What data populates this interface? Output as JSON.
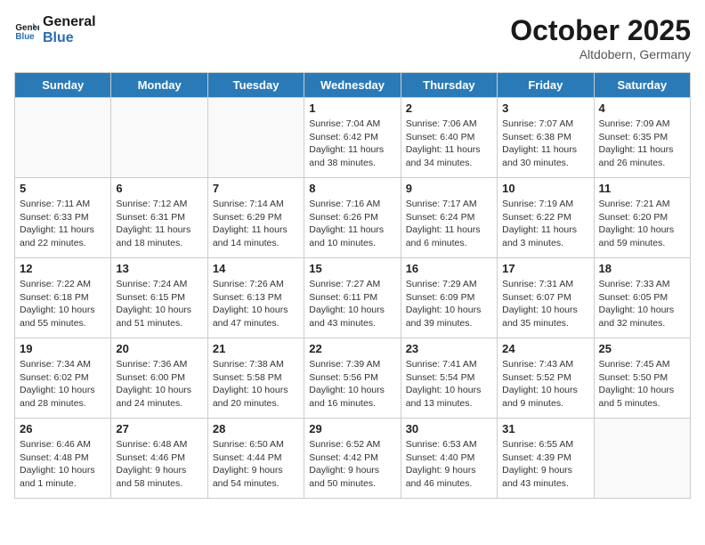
{
  "header": {
    "logo_line1": "General",
    "logo_line2": "Blue",
    "month": "October 2025",
    "location": "Altdobern, Germany"
  },
  "weekdays": [
    "Sunday",
    "Monday",
    "Tuesday",
    "Wednesday",
    "Thursday",
    "Friday",
    "Saturday"
  ],
  "weeks": [
    [
      {
        "day": null,
        "info": null
      },
      {
        "day": null,
        "info": null
      },
      {
        "day": null,
        "info": null
      },
      {
        "day": "1",
        "sunrise": "7:04 AM",
        "sunset": "6:42 PM",
        "daylight": "11 hours and 38 minutes."
      },
      {
        "day": "2",
        "sunrise": "7:06 AM",
        "sunset": "6:40 PM",
        "daylight": "11 hours and 34 minutes."
      },
      {
        "day": "3",
        "sunrise": "7:07 AM",
        "sunset": "6:38 PM",
        "daylight": "11 hours and 30 minutes."
      },
      {
        "day": "4",
        "sunrise": "7:09 AM",
        "sunset": "6:35 PM",
        "daylight": "11 hours and 26 minutes."
      }
    ],
    [
      {
        "day": "5",
        "sunrise": "7:11 AM",
        "sunset": "6:33 PM",
        "daylight": "11 hours and 22 minutes."
      },
      {
        "day": "6",
        "sunrise": "7:12 AM",
        "sunset": "6:31 PM",
        "daylight": "11 hours and 18 minutes."
      },
      {
        "day": "7",
        "sunrise": "7:14 AM",
        "sunset": "6:29 PM",
        "daylight": "11 hours and 14 minutes."
      },
      {
        "day": "8",
        "sunrise": "7:16 AM",
        "sunset": "6:26 PM",
        "daylight": "11 hours and 10 minutes."
      },
      {
        "day": "9",
        "sunrise": "7:17 AM",
        "sunset": "6:24 PM",
        "daylight": "11 hours and 6 minutes."
      },
      {
        "day": "10",
        "sunrise": "7:19 AM",
        "sunset": "6:22 PM",
        "daylight": "11 hours and 3 minutes."
      },
      {
        "day": "11",
        "sunrise": "7:21 AM",
        "sunset": "6:20 PM",
        "daylight": "10 hours and 59 minutes."
      }
    ],
    [
      {
        "day": "12",
        "sunrise": "7:22 AM",
        "sunset": "6:18 PM",
        "daylight": "10 hours and 55 minutes."
      },
      {
        "day": "13",
        "sunrise": "7:24 AM",
        "sunset": "6:15 PM",
        "daylight": "10 hours and 51 minutes."
      },
      {
        "day": "14",
        "sunrise": "7:26 AM",
        "sunset": "6:13 PM",
        "daylight": "10 hours and 47 minutes."
      },
      {
        "day": "15",
        "sunrise": "7:27 AM",
        "sunset": "6:11 PM",
        "daylight": "10 hours and 43 minutes."
      },
      {
        "day": "16",
        "sunrise": "7:29 AM",
        "sunset": "6:09 PM",
        "daylight": "10 hours and 39 minutes."
      },
      {
        "day": "17",
        "sunrise": "7:31 AM",
        "sunset": "6:07 PM",
        "daylight": "10 hours and 35 minutes."
      },
      {
        "day": "18",
        "sunrise": "7:33 AM",
        "sunset": "6:05 PM",
        "daylight": "10 hours and 32 minutes."
      }
    ],
    [
      {
        "day": "19",
        "sunrise": "7:34 AM",
        "sunset": "6:02 PM",
        "daylight": "10 hours and 28 minutes."
      },
      {
        "day": "20",
        "sunrise": "7:36 AM",
        "sunset": "6:00 PM",
        "daylight": "10 hours and 24 minutes."
      },
      {
        "day": "21",
        "sunrise": "7:38 AM",
        "sunset": "5:58 PM",
        "daylight": "10 hours and 20 minutes."
      },
      {
        "day": "22",
        "sunrise": "7:39 AM",
        "sunset": "5:56 PM",
        "daylight": "10 hours and 16 minutes."
      },
      {
        "day": "23",
        "sunrise": "7:41 AM",
        "sunset": "5:54 PM",
        "daylight": "10 hours and 13 minutes."
      },
      {
        "day": "24",
        "sunrise": "7:43 AM",
        "sunset": "5:52 PM",
        "daylight": "10 hours and 9 minutes."
      },
      {
        "day": "25",
        "sunrise": "7:45 AM",
        "sunset": "5:50 PM",
        "daylight": "10 hours and 5 minutes."
      }
    ],
    [
      {
        "day": "26",
        "sunrise": "6:46 AM",
        "sunset": "4:48 PM",
        "daylight": "10 hours and 1 minute."
      },
      {
        "day": "27",
        "sunrise": "6:48 AM",
        "sunset": "4:46 PM",
        "daylight": "9 hours and 58 minutes."
      },
      {
        "day": "28",
        "sunrise": "6:50 AM",
        "sunset": "4:44 PM",
        "daylight": "9 hours and 54 minutes."
      },
      {
        "day": "29",
        "sunrise": "6:52 AM",
        "sunset": "4:42 PM",
        "daylight": "9 hours and 50 minutes."
      },
      {
        "day": "30",
        "sunrise": "6:53 AM",
        "sunset": "4:40 PM",
        "daylight": "9 hours and 46 minutes."
      },
      {
        "day": "31",
        "sunrise": "6:55 AM",
        "sunset": "4:39 PM",
        "daylight": "9 hours and 43 minutes."
      },
      {
        "day": null,
        "info": null
      }
    ]
  ],
  "labels": {
    "sunrise_prefix": "Sunrise: ",
    "sunset_prefix": "Sunset: ",
    "daylight_prefix": "Daylight: "
  }
}
